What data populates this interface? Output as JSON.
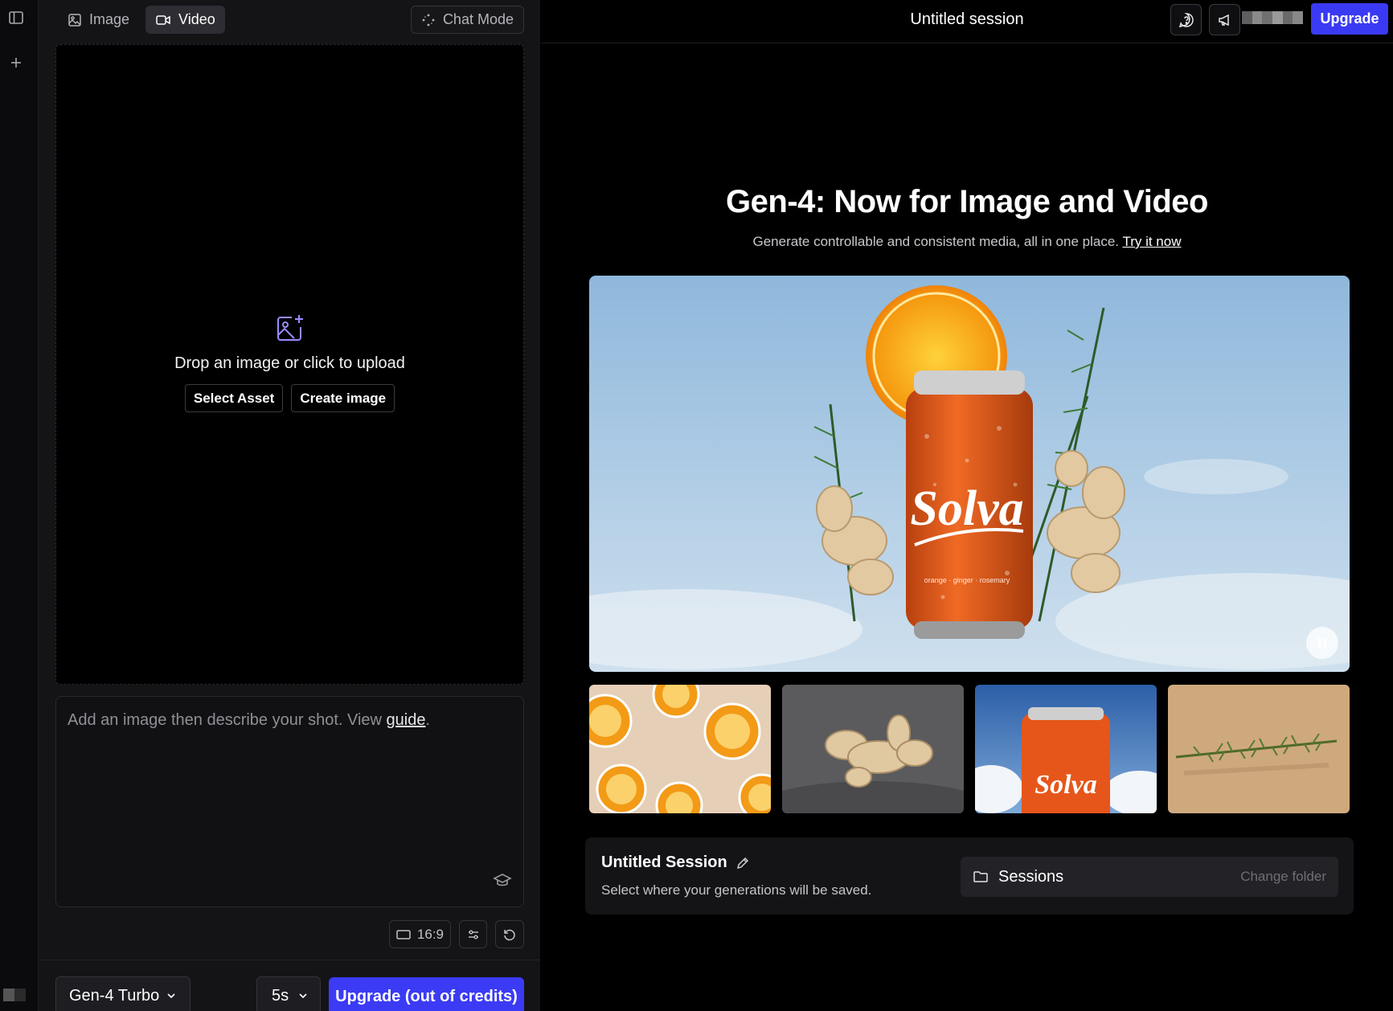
{
  "left_tabs": {
    "image": "Image",
    "video": "Video",
    "chat_mode": "Chat Mode"
  },
  "dropzone": {
    "text": "Drop an image or click to upload",
    "select_asset": "Select Asset",
    "create_image": "Create image"
  },
  "prompt": {
    "placeholder": "Add an image then describe your shot. View ",
    "guide_link": "guide",
    "period": "."
  },
  "tools": {
    "aspect_ratio": "16:9"
  },
  "bottom": {
    "model": "Gen-4 Turbo",
    "duration": "5s",
    "upgrade": "Upgrade (out of credits)"
  },
  "topbar": {
    "session_title": "Untitled session",
    "upgrade": "Upgrade"
  },
  "hero": {
    "title": "Gen-4: Now for Image and Video",
    "subtitle": "Generate controllable and consistent media, all in one place.",
    "link": "Try it now",
    "brand": "Solva",
    "can_text": "orange · ginger · rosemary"
  },
  "session_card": {
    "title": "Untitled Session",
    "subtitle": "Select where your generations will be saved.",
    "folder": "Sessions",
    "change_folder": "Change folder"
  },
  "colors": {
    "accent": "#3b3bf5",
    "panel": "#141417",
    "sky": "#a7c6e2",
    "can": "#e0561c"
  }
}
